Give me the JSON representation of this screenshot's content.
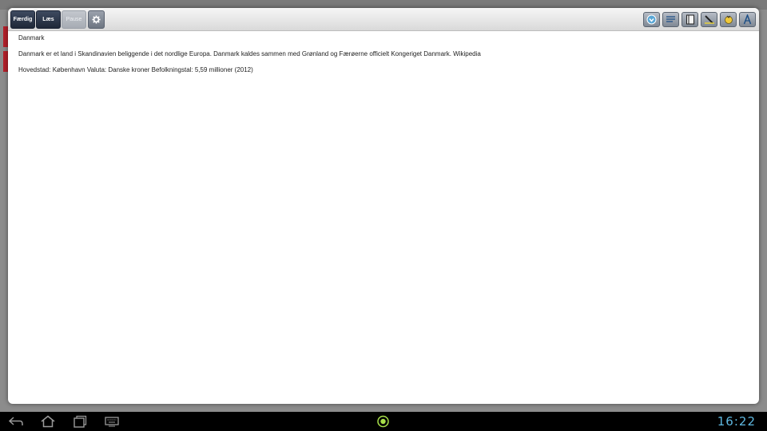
{
  "toolbar": {
    "done_label": "Færdig",
    "read_label": "Læs",
    "pause_label": "Pause",
    "settings_icon": "gear-icon",
    "right_icons": [
      "speech-icon",
      "list-icon",
      "book-icon",
      "highlight-pen-icon",
      "sound-icon",
      "font-icon"
    ]
  },
  "content": {
    "title": "Danmark",
    "paragraph": "Danmark er et land i Skandinavien beliggende i det nordlige Europa. Danmark kaldes sammen med Grønland og Færøerne officielt Kongeriget Danmark. Wikipedia",
    "facts": "Hovedstad: København Valuta: Danske kroner Befolkningstal: 5,59 millioner (2012)"
  },
  "navbar": {
    "icons": [
      "back-icon",
      "home-icon",
      "recent-apps-icon",
      "keyboard-icon",
      "center-indicator-icon"
    ],
    "time": "16:22"
  },
  "colors": {
    "accent_dark": "#1f2838",
    "clock": "#5fb8e0",
    "indicator": "#a8e04a"
  }
}
